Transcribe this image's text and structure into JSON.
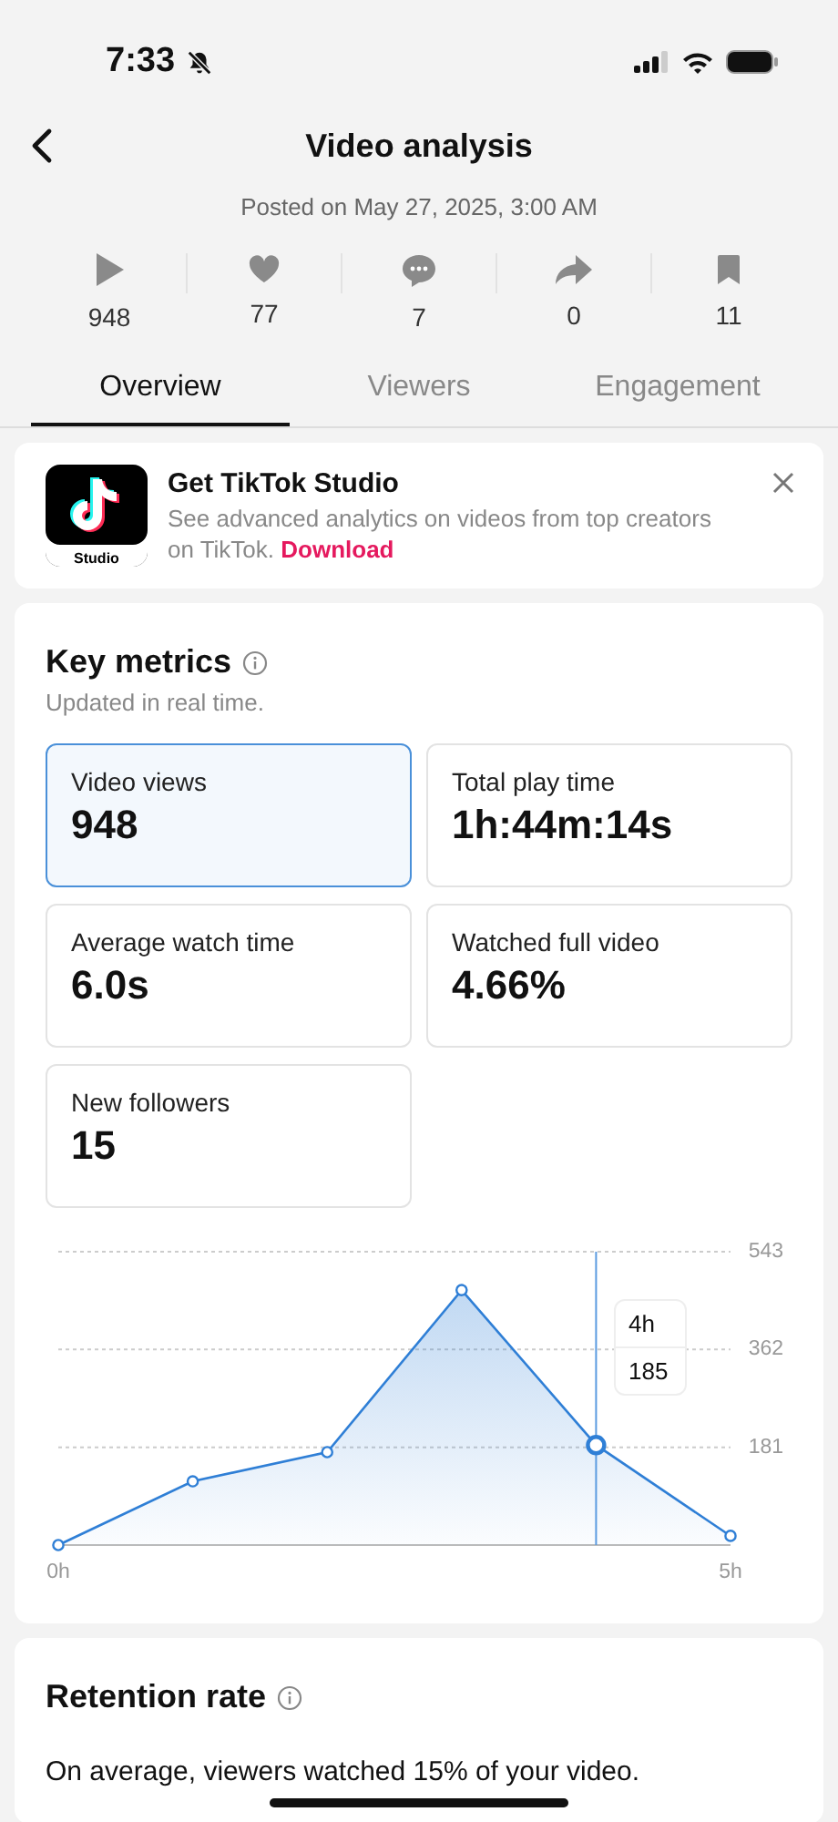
{
  "status_bar": {
    "time": "7:33",
    "silenced": true
  },
  "header": {
    "title": "Video analysis",
    "posted": "Posted on May 27, 2025, 3:00 AM"
  },
  "stats": [
    {
      "kind": "play",
      "value": "948"
    },
    {
      "kind": "like",
      "value": "77"
    },
    {
      "kind": "comment",
      "value": "7"
    },
    {
      "kind": "share",
      "value": "0"
    },
    {
      "kind": "save",
      "value": "11"
    }
  ],
  "tabs": [
    {
      "label": "Overview",
      "selected": true
    },
    {
      "label": "Viewers",
      "selected": false
    },
    {
      "label": "Engagement",
      "selected": false
    }
  ],
  "banner": {
    "app_label": "Studio",
    "title": "Get TikTok Studio",
    "text": "See advanced analytics on videos from top creators on TikTok.",
    "link": "Download"
  },
  "key_metrics": {
    "title": "Key metrics",
    "subtitle": "Updated in real time.",
    "cards": [
      {
        "label": "Video views",
        "value": "948",
        "selected": true
      },
      {
        "label": "Total play time",
        "value": "1h:44m:14s",
        "selected": false
      },
      {
        "label": "Average watch time",
        "value": "6.0s",
        "selected": false
      },
      {
        "label": "Watched full video",
        "value": "4.66%",
        "selected": false
      },
      {
        "label": "New followers",
        "value": "15",
        "selected": false
      }
    ],
    "chart_data": {
      "type": "area",
      "x": [
        0,
        1,
        2,
        3,
        4,
        5
      ],
      "series": [
        {
          "color": "#2f7fd6",
          "values": [
            0,
            118,
            172,
            472,
            185,
            17
          ]
        }
      ],
      "xlim": [
        0,
        5
      ],
      "xticks": [
        {
          "value": 0,
          "label": "0h"
        },
        {
          "value": 5,
          "label": "5h"
        }
      ],
      "yticks": [
        181,
        362,
        543
      ],
      "ylim": [
        0,
        543
      ],
      "ref_lines": [
        {
          "axis": "x",
          "value": 4
        }
      ]
    },
    "tooltip": {
      "time": "4h",
      "value": "185"
    }
  },
  "retention": {
    "title": "Retention rate",
    "text": "On average, viewers watched 15% of your video."
  }
}
